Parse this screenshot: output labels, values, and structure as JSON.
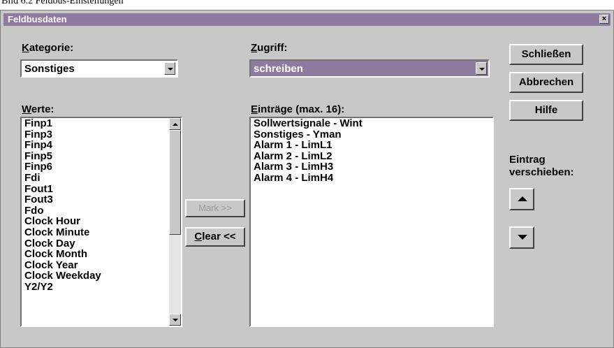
{
  "top_strip_text": "Bild 6.2 Feldbus-Einstellungen",
  "window": {
    "title": "Feldbusdaten",
    "close_glyph": "×"
  },
  "kategorie": {
    "label_u": "K",
    "label_rest": "ategorie:",
    "value": "Sonstiges"
  },
  "zugriff": {
    "label_u": "Z",
    "label_rest": "ugriff:",
    "value": "schreiben"
  },
  "werte": {
    "label_u": "W",
    "label_rest": "erte:",
    "items": [
      "Finp1",
      "Finp3",
      "Finp4",
      "Finp5",
      "Finp6",
      "Fdi",
      "Fout1",
      "Fout3",
      "Fdo",
      "Clock Hour",
      "Clock Minute",
      "Clock Day",
      "Clock Month",
      "Clock Year",
      "Clock Weekday",
      "Y2/Y2"
    ]
  },
  "eintraege": {
    "label_u": "E",
    "label_rest": "inträge (max. 16):",
    "items": [
      "Sollwertsignale - Wint",
      "Sonstiges - Yman",
      "Alarm 1 - LimL1",
      "Alarm 2 - LimL2",
      "Alarm 3 - LimH3",
      "Alarm 4 - LimH4"
    ]
  },
  "buttons": {
    "mark": "Mark >>",
    "clear_u": "C",
    "clear_rest": "lear <<",
    "schliessen": "Schließen",
    "abbrechen": "Abbrechen",
    "hilfe": "Hilfe"
  },
  "eintrag_verschieben": {
    "line1": "Eintrag",
    "line2": "verschieben:"
  },
  "colors": {
    "dialog_bg": "#c8c8c8",
    "titlebar": "#8f7aa0",
    "selection": "#8f7aa0"
  }
}
